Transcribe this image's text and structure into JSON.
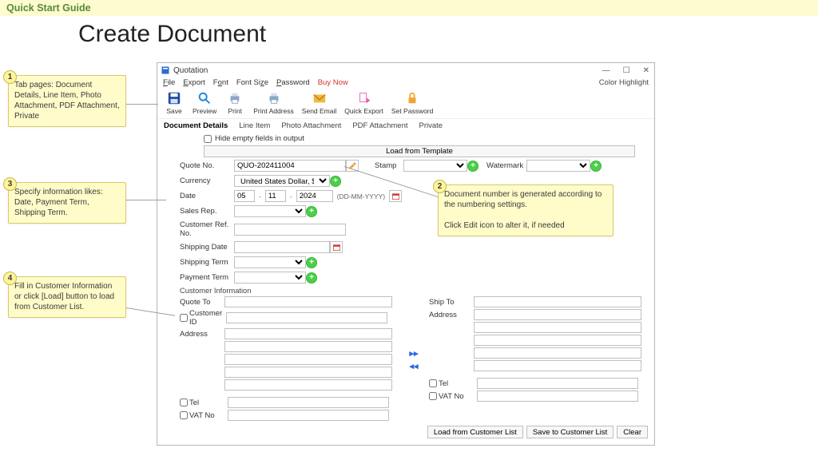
{
  "banner": {
    "title": "Quick Start Guide"
  },
  "page": {
    "title": "Create Document"
  },
  "callouts": {
    "c1": {
      "num": "1",
      "text": "Tab pages: Document Details, Line Item, Photo Attachment, PDF Attachment, Private"
    },
    "c2": {
      "num": "2",
      "text": "Document number is generated according to the numbering settings.\n\nClick Edit icon to alter it, if needed"
    },
    "c3": {
      "num": "3",
      "text": "Specify information likes: Date, Payment Term, Shipping Term."
    },
    "c4": {
      "num": "4",
      "text": "Fill in Customer Information or click [Load] button to load from Customer List."
    }
  },
  "window": {
    "title": "Quotation",
    "menu": {
      "file": "File",
      "export": "Export",
      "font": "Font",
      "fontsize": "Font Size",
      "password": "Password",
      "buy": "Buy Now",
      "highlight": "Color Highlight"
    },
    "toolbar": {
      "save": "Save",
      "preview": "Preview",
      "print": "Print",
      "printaddr": "Print Address",
      "email": "Send Email",
      "quick": "Quick Export",
      "setpw": "Set Password"
    },
    "tabs": {
      "t1": "Document Details",
      "t2": "Line Item",
      "t3": "Photo Attachment",
      "t4": "PDF Attachment",
      "t5": "Private"
    }
  },
  "form": {
    "hide_empty": "Hide empty fields in output",
    "load_template": "Load from Template",
    "labels": {
      "quote_no": "Quote No.",
      "stamp": "Stamp",
      "watermark": "Watermark",
      "currency": "Currency",
      "date": "Date",
      "date_fmt": "(DD-MM-YYYY)",
      "sales_rep": "Sales Rep.",
      "cust_ref": "Customer Ref. No.",
      "ship_date": "Shipping Date",
      "ship_term": "Shipping Term",
      "pay_term": "Payment Term",
      "cust_section": "Customer Information",
      "quote_to": "Quote To",
      "customer_id": "Customer ID",
      "address": "Address",
      "tel": "Tel",
      "vat": "VAT No",
      "ship_to": "Ship To"
    },
    "values": {
      "quote_no": "QUO-202411004",
      "currency": "United States Dollar, $",
      "date_d": "05",
      "date_m": "11",
      "date_y": "2024"
    },
    "buttons": {
      "load_cust": "Load from Customer List",
      "save_cust": "Save to Customer List",
      "clear": "Clear"
    }
  }
}
